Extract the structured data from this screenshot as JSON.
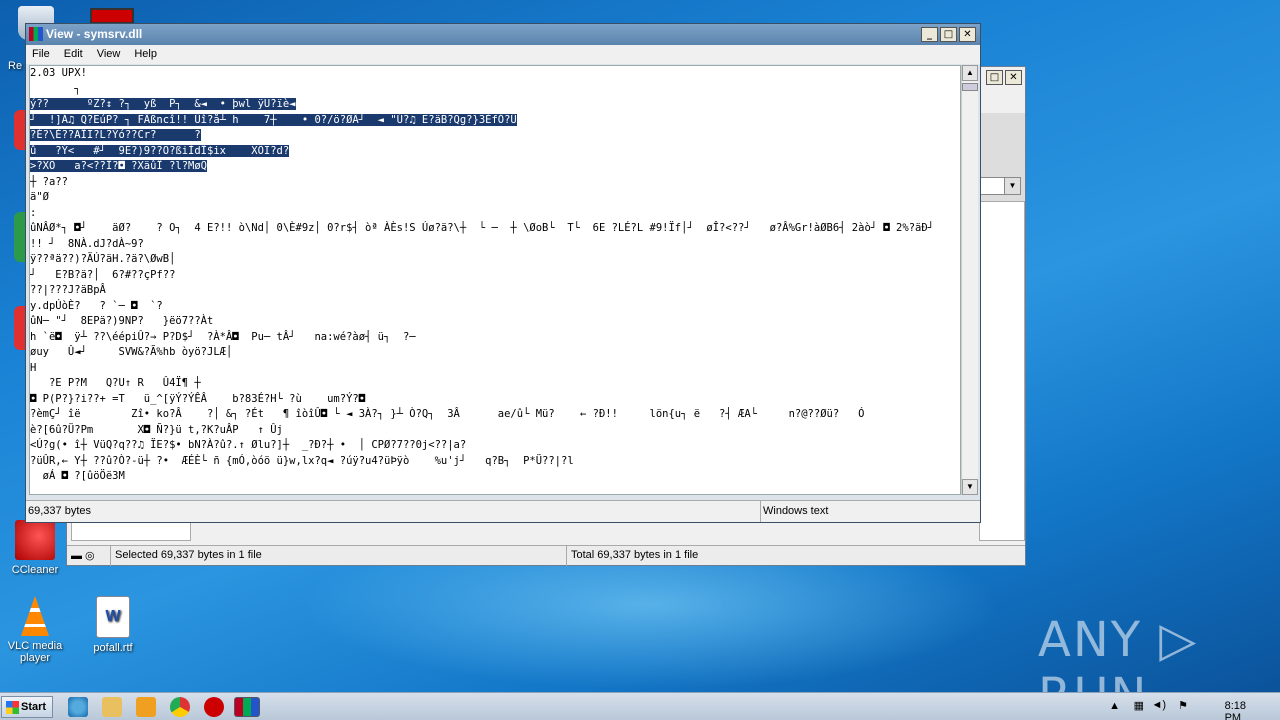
{
  "window": {
    "title": "View - symsrv.dll"
  },
  "menu": [
    "File",
    "Edit",
    "View",
    "Help"
  ],
  "text_lines": [
    {
      "t": "2.03 UPX!",
      "sel": false
    },
    {
      "t": "       ┐",
      "sel": false
    },
    {
      "t": "ý??      ºZ?↕ ?┐  yß  P┐  &◄  • þwl ÿU?ïè◄",
      "sel": true
    },
    {
      "t": "┘  !]Ã♫ Q?EúP? ┐ FÂßncî!! Ûî?å┴ h    7┼    • 0?/ö?ØÄ┘  ◄ \"Ú?♫ E?äB?Qg?}3ÉfÓ?Ü",
      "sel": true
    },
    {
      "t": "?É?\\È??ÃÎI?L?Ýó??Cr?      ?",
      "sel": true
    },
    {
      "t": "û   ?Ý<   #┘  9E?)9??O?ßiÌdÎ$ix    XÕI?d?",
      "sel": true
    },
    {
      "t": ">?XÕ   a?<??Î?◘ ?XäûÎ ?l?MøQ",
      "sel": true
    },
    {
      "t": "┼ ?a??",
      "sel": false
    },
    {
      "t": "ä\"Ø",
      "sel": false
    },
    {
      "t": ":",
      "sel": false
    },
    {
      "t": "ûNÂØ*┐ ◘┘    äØ?    ? O┐  4 E?!! ò\\Nd│ 0\\È#9z│ 0?r$┤ òª ÀÈs!S Úø?ä?\\┼  └ ─  ┼ \\ØoB└  T└  6E ?LÉ?L #9!Ïf│┘  øÎ?<??┘   ø?Â%Gr!àØB6┤ 2àò┘ ◘ 2%?äÐ┘     ÐäB?",
      "sel": false
    },
    {
      "t": "!! ┘  8NÀ.dJ?dÀ~9?",
      "sel": false
    },
    {
      "t": "ÿ??ªä??)?ÄÚ?äH.?ä?\\ØwB│",
      "sel": false
    },
    {
      "t": "┘   E?B?ä?│  6?#??çPf??",
      "sel": false
    },
    {
      "t": "??|???J?äBpÂ",
      "sel": false
    },
    {
      "t": "y.dpÚòÈ?   ? `─ ◘  `?",
      "sel": false
    },
    {
      "t": "ûN─ \"┘  8EPä?)9NP?   }ëö7??Àt",
      "sel": false
    },
    {
      "t": "h `ë◘  ÿ┴ ??\\éépiÛ?→ P?D$┘  ?À*Â◘  Pu─ tÂ┘   na:wé?àø┤ ü┐  ?─",
      "sel": false
    },
    {
      "t": "øuy   Û◄┘     SVW&?Ã%hb òyö?JLÆ│",
      "sel": false
    },
    {
      "t": "H",
      "sel": false
    },
    {
      "t": "   ?E P?M   Q?U↑ R   Û4Ï¶ ┼",
      "sel": false
    },
    {
      "t": "◘ P(P?}?i??+ =T   ü_^[ÿÝ?ÝÊÂ    b?83É?H└ ?ù    um?Ý?◘",
      "sel": false
    },
    {
      "t": "?èmÇ┘ îë        Zî• ko?Â    ?│ &┐ ?Ét   ¶ îòîÛ◘ └ ◄ 3À?┐ }┴ Ò?Q┐  3Â      ae/û└ Mü?    ← ?Ð!!     lön{u┐ ë   ?┤ ÆA└     n?@??Øü?   Ó",
      "sel": false
    },
    {
      "t": "è?[6û?Ü?Pm       X◘ Ñ?}ü t,?K?uÂP   ↑ Ûj",
      "sel": false
    },
    {
      "t": "<Ú?g(• î┼ VüQ?q??♫ ÏE?$• bN?À?û?.↑ Ølu?]┼  _?Ð?┼ •  │ CPØ?7??0j<??|a?",
      "sel": false
    },
    {
      "t": "?üÛR,← Y┼ ??û?Ò?-ü┼ ?•  ÆÉÈ└ ñ {mÓ,òóö ü}w,lx?q◄ ?úÿ?u4?üÞÿò    %u'j┘   q?B┐  P*Ü??|?l",
      "sel": false
    },
    {
      "t": "  øÁ ◘ ?[ûöÖë3M",
      "sel": false
    }
  ],
  "status": {
    "size": "69,337 bytes",
    "encoding": "Windows text"
  },
  "back_status": {
    "selected": "Selected 69,337 bytes in 1 file",
    "total": "Total 69,337 bytes in 1 file"
  },
  "desktop": {
    "ccleaner": "CCleaner",
    "vlc": "VLC media player",
    "rtf": "pofall.rtf",
    "recycle_fragment": "Re"
  },
  "taskbar": {
    "start": "Start",
    "clock": "8:18 PM"
  },
  "watermark": "ANY ▷ RUN"
}
